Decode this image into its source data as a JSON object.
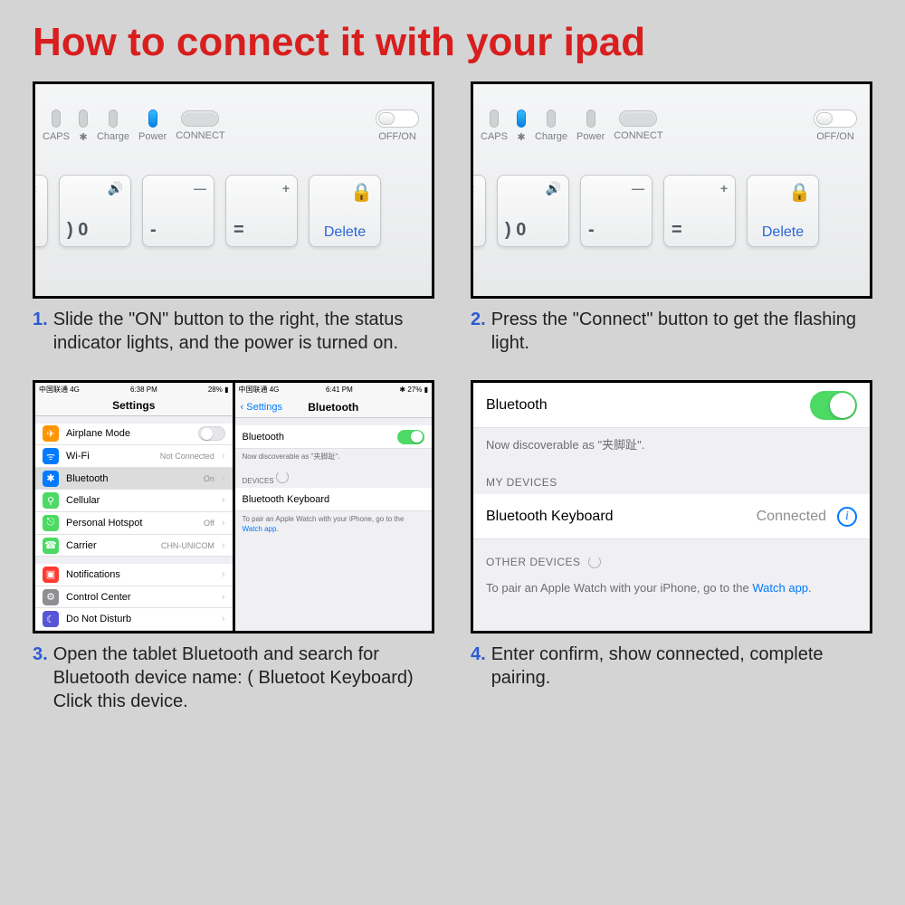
{
  "title": "How to connect it with your ipad",
  "steps": {
    "s1": {
      "num": "1.",
      "text": "Slide the \"ON\" button to the right, the status indicator lights, and the power is turned on."
    },
    "s2": {
      "num": "2.",
      "text": "Press the \"Connect\" button to get the flashing light."
    },
    "s3": {
      "num": "3.",
      "text": "Open the tablet Bluetooth and search for Bluetooth device name: (  Bluetoot Keyboard) Click this device."
    },
    "s4": {
      "num": "4.",
      "text": "Enter confirm, show connected, complete pairing."
    }
  },
  "keyboard": {
    "indicators": {
      "caps": "CAPS",
      "bt": "✱",
      "charge": "Charge",
      "power": "Power",
      "connect": "CONNECT",
      "offon": "OFF/ON"
    },
    "keys": {
      "volup_top": "🔊",
      "volup_main": ") 0",
      "minus_top": "—",
      "minus_main": "-",
      "plus_top": "+",
      "plus_main": "=",
      "delete": "Delete",
      "lock": "🔒"
    }
  },
  "ios_left": {
    "status": {
      "carrier": "中国联通  4G",
      "time": "6:38 PM",
      "batt": "28% ▮"
    },
    "title": "Settings",
    "rows": {
      "airplane": "Airplane Mode",
      "wifi": "Wi-Fi",
      "wifi_val": "Not Connected",
      "bluetooth": "Bluetooth",
      "bluetooth_val": "On",
      "cellular": "Cellular",
      "hotspot": "Personal Hotspot",
      "hotspot_val": "Off",
      "carrier": "Carrier",
      "carrier_val": "CHN-UNICOM",
      "notifications": "Notifications",
      "control": "Control Center",
      "dnd": "Do Not Disturb"
    }
  },
  "ios_right": {
    "status": {
      "carrier": "中国联通  4G",
      "time": "6:41 PM",
      "batt": "✱ 27% ▮"
    },
    "back": "Settings",
    "title": "Bluetooth",
    "bluetooth_label": "Bluetooth",
    "discoverable": "Now discoverable as \"夹脚趾\".",
    "devices_label": "DEVICES",
    "device_row": "Bluetooth Keyboard",
    "pair_note_a": "To pair an Apple Watch with your iPhone, go to the ",
    "pair_note_b": "Watch app"
  },
  "ios_big": {
    "bluetooth_label": "Bluetooth",
    "discoverable": "Now discoverable as \"夹脚趾\".",
    "my_devices": "MY DEVICES",
    "device_row": "Bluetooth Keyboard",
    "device_status": "Connected",
    "other_devices": "OTHER DEVICES",
    "pair_note_a": "To pair an Apple Watch with your iPhone, go to the ",
    "pair_note_b": "Watch app",
    "pair_note_c": "."
  }
}
